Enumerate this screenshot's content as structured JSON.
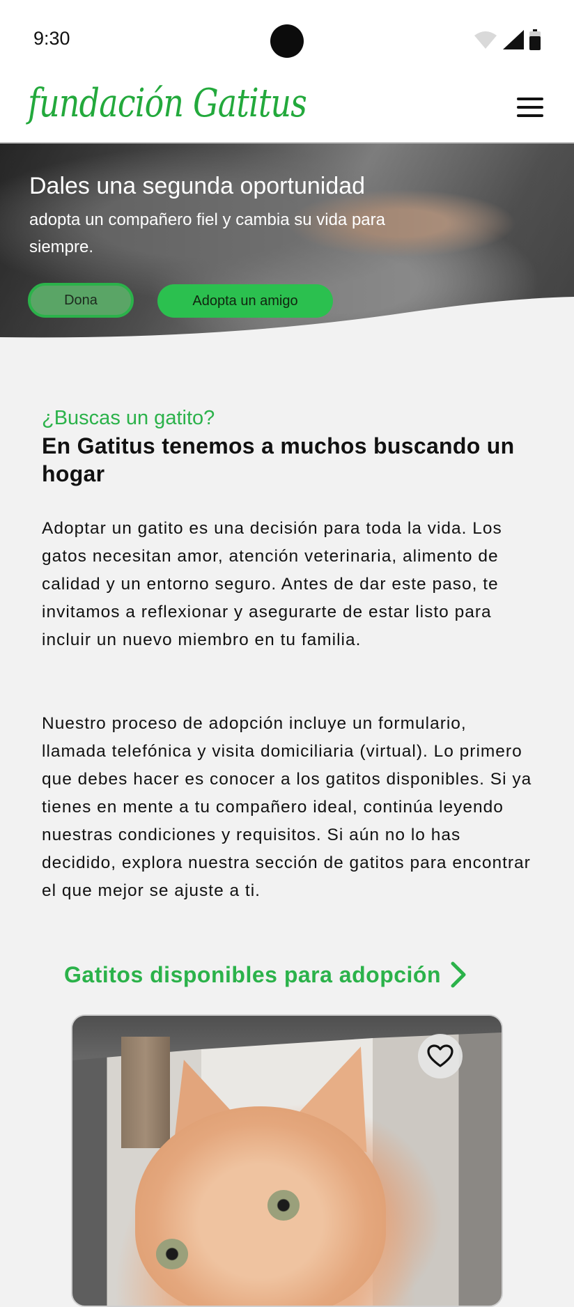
{
  "status_bar": {
    "time": "9:30",
    "icons": [
      "wifi-icon",
      "signal-icon",
      "battery-icon"
    ]
  },
  "header": {
    "logo": "fundación Gatitus",
    "menu_icon": "hamburger-menu-icon"
  },
  "hero": {
    "title": "Dales una segunda oportunidad",
    "subtitle": "adopta un compañero fiel y cambia su vida para siempre.",
    "donate_label": "Dona",
    "adopt_label": "Adopta un amigo"
  },
  "intro": {
    "kicker": "¿Buscas un gatito?",
    "heading": "En Gatitus tenemos a muchos buscando un hogar",
    "paragraph1": "Adoptar un gatito es una decisión para toda la vida. Los gatos necesitan amor, atención veterinaria, alimento de calidad y un entorno seguro. Antes de dar este paso, te invitamos a reflexionar y asegurarte de estar listo para incluir un nuevo miembro en tu familia.",
    "paragraph2": "Nuestro proceso de adopción incluye un formulario, llamada telefónica y visita domiciliaria (virtual). Lo primero que debes hacer es conocer a los gatitos disponibles. Si ya tienes en mente a tu compañero ideal, continúa leyendo nuestras condiciones y requisitos. Si aún no lo has decidido, explora nuestra sección de gatitos para encontrar el que mejor se ajuste a ti."
  },
  "available": {
    "label": "Gatitos disponibles para adopción",
    "icon": "chevron-right-icon"
  },
  "colors": {
    "brand_green": "#2bb24a",
    "background": "#f2f2f2"
  }
}
